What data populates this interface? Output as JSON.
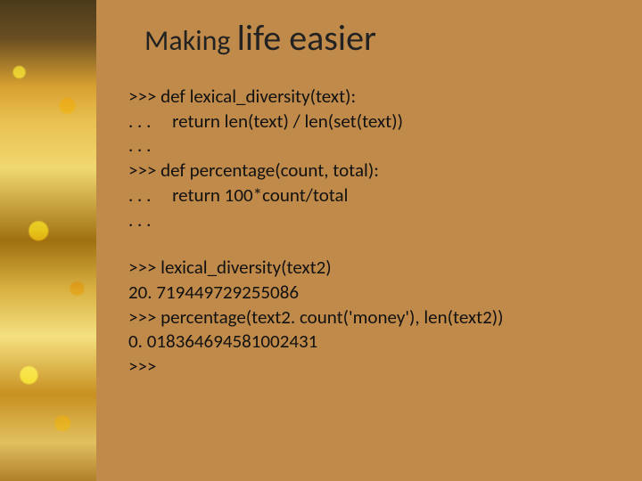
{
  "title": {
    "part1": "Making ",
    "part2": "life easier"
  },
  "code1": {
    "l1": ">>> def lexical_diversity(text):",
    "l2": ". . .     return len(text) / len(set(text))",
    "l3": ". . .",
    "l4": ">>> def percentage(count, total):",
    "l5": ". . .     return 100*count/total",
    "l6": ". . ."
  },
  "code2": {
    "l1": ">>> lexical_diversity(text2)",
    "l2": "20. 719449729255086",
    "l3": ">>> percentage(text2. count('money'), len(text2))",
    "l4": "0. 018364694581002431",
    "l5": ">>>"
  }
}
